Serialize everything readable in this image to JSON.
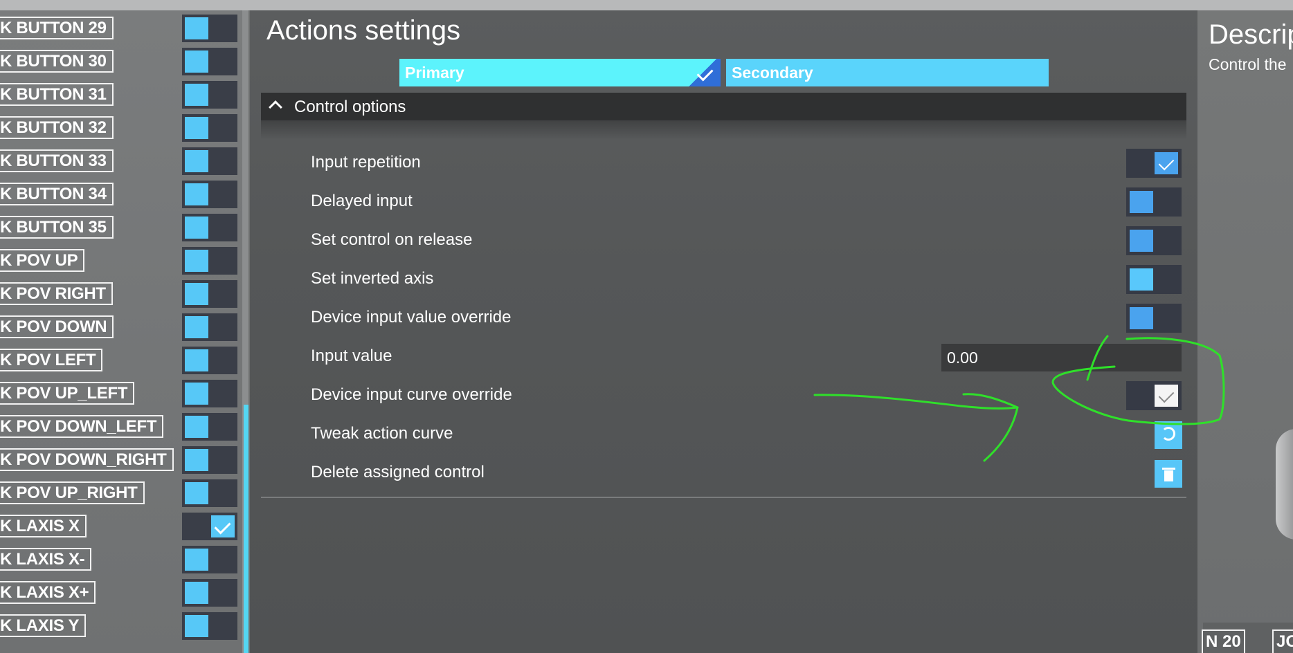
{
  "key_list": [
    {
      "label": "K BUTTON 29",
      "checked": false
    },
    {
      "label": "K BUTTON 30",
      "checked": false
    },
    {
      "label": "K BUTTON 31",
      "checked": false
    },
    {
      "label": "K BUTTON 32",
      "checked": false
    },
    {
      "label": "K BUTTON 33",
      "checked": false
    },
    {
      "label": "K BUTTON 34",
      "checked": false
    },
    {
      "label": "K BUTTON 35",
      "checked": false
    },
    {
      "label": "K POV UP",
      "checked": false
    },
    {
      "label": "K POV RIGHT",
      "checked": false
    },
    {
      "label": "K POV DOWN",
      "checked": false
    },
    {
      "label": "K POV LEFT",
      "checked": false
    },
    {
      "label": "K POV UP_LEFT",
      "checked": false
    },
    {
      "label": "K POV DOWN_LEFT",
      "checked": false
    },
    {
      "label": "K POV DOWN_RIGHT",
      "checked": false
    },
    {
      "label": "K POV UP_RIGHT",
      "checked": false
    },
    {
      "label": "K LAXIS X",
      "checked": true
    },
    {
      "label": "K LAXIS X-",
      "checked": false
    },
    {
      "label": "K LAXIS X+",
      "checked": false
    },
    {
      "label": "K LAXIS Y",
      "checked": false
    }
  ],
  "actions_panel": {
    "title": "Actions settings",
    "tabs": [
      {
        "label": "Primary",
        "selected": true
      },
      {
        "label": "Secondary",
        "selected": false
      }
    ],
    "section": {
      "title": "Control options",
      "options": [
        {
          "label": "Input repetition",
          "control": "toggle",
          "checked": true
        },
        {
          "label": "Delayed input",
          "control": "toggle",
          "checked": false
        },
        {
          "label": "Set control on release",
          "control": "toggle",
          "checked": false
        },
        {
          "label": "Set inverted axis",
          "control": "toggle",
          "checked": false
        },
        {
          "label": "Device input value override",
          "control": "toggle",
          "checked": false
        },
        {
          "label": "Input value",
          "control": "field",
          "value": "0.00"
        },
        {
          "label": "Device input curve override",
          "control": "toggle",
          "checked": true
        },
        {
          "label": "Tweak action curve",
          "control": "button",
          "icon": "curve-icon"
        },
        {
          "label": "Delete assigned control",
          "control": "button",
          "icon": "trash-icon"
        }
      ]
    }
  },
  "description_panel": {
    "title": "Descrip",
    "text": "Control the",
    "bottom_keys": [
      "N 20",
      "JO"
    ]
  },
  "colors": {
    "toggle_knob": "#4aa3ee",
    "toggle_knob_bright": "#59c8fb",
    "tab_primary": "#5cf3fc",
    "tab_secondary": "#5ad4fb",
    "annotation": "#2fe02a"
  }
}
